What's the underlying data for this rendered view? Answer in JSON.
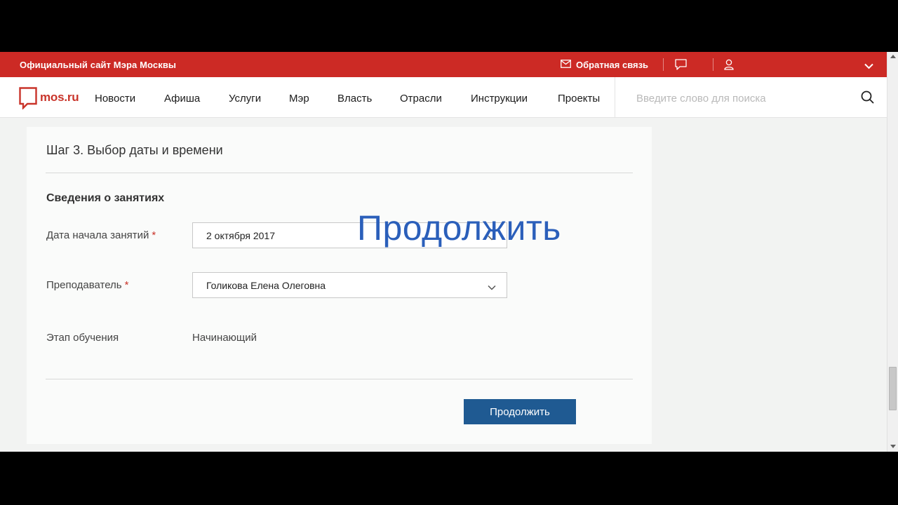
{
  "topbar": {
    "site_title": "Официальный сайт Мэра Москвы",
    "feedback_label": "Обратная связь"
  },
  "navbar": {
    "logo_text": "mos.ru",
    "items": [
      "Новости",
      "Афиша",
      "Услуги",
      "Мэр",
      "Власть",
      "Отрасли",
      "Инструкции",
      "Проекты"
    ],
    "search_placeholder": "Введите слово для поиска"
  },
  "form": {
    "step_title": "Шаг 3. Выбор даты и времени",
    "section_title": "Сведения о занятиях",
    "fields": {
      "start_date": {
        "label": "Дата начала занятий",
        "required_mark": "*",
        "value": "2 октября 2017"
      },
      "teacher": {
        "label": "Преподаватель",
        "required_mark": "*",
        "value": "Голикова Елена Олеговна"
      },
      "stage": {
        "label": "Этап обучения",
        "value": "Начинающий"
      }
    },
    "continue_label": "Продолжить"
  },
  "overlay": {
    "text": "Продолжить"
  },
  "colors": {
    "brand_red": "#cc2a25",
    "button_blue": "#1f5a92",
    "overlay_blue": "#2b5fba"
  }
}
